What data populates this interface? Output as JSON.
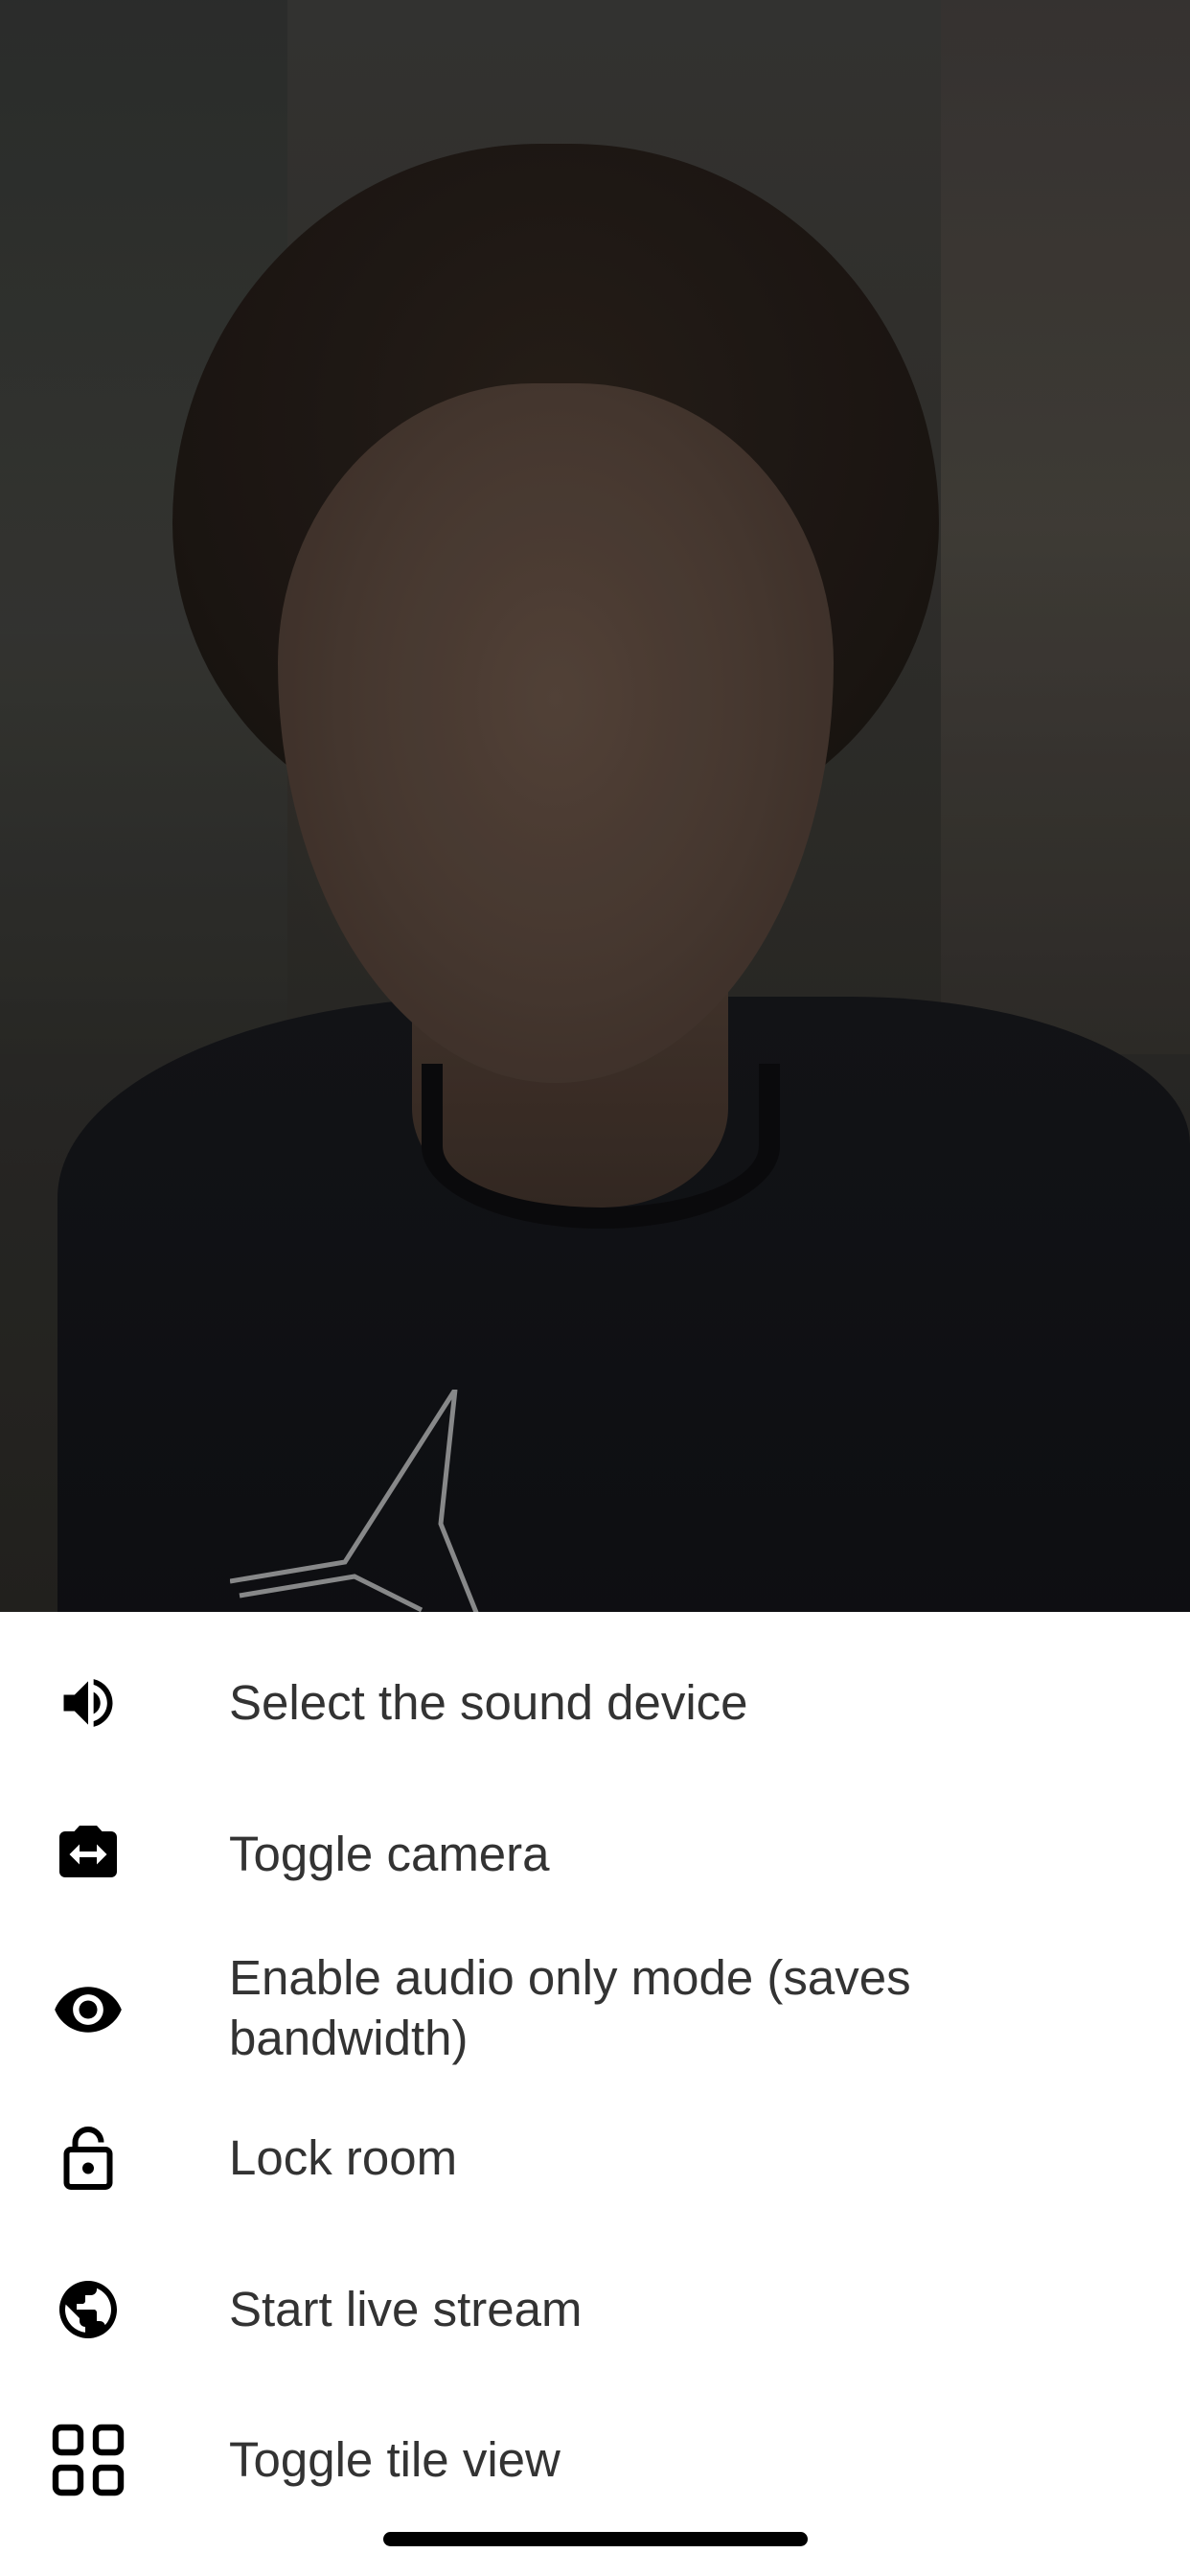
{
  "menu": {
    "items": [
      {
        "icon": "volume-icon",
        "label": "Select the sound device"
      },
      {
        "icon": "switch-camera-icon",
        "label": "Toggle camera"
      },
      {
        "icon": "eye-icon",
        "label": "Enable audio only mode (saves bandwidth)"
      },
      {
        "icon": "lock-open-icon",
        "label": "Lock room"
      },
      {
        "icon": "globe-icon",
        "label": "Start live stream"
      },
      {
        "icon": "tile-view-icon",
        "label": "Toggle tile view"
      }
    ]
  },
  "colors": {
    "sheet_background": "#ffffff",
    "label_text": "#333333",
    "icon": "#000000",
    "home_indicator": "#000000"
  }
}
